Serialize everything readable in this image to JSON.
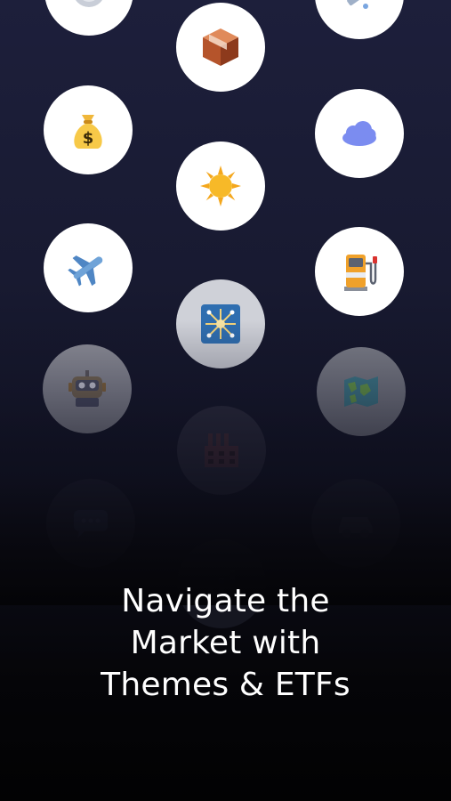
{
  "onboarding": {
    "headline_lines": [
      "Navigate the",
      "Market with",
      "Themes & ETFs"
    ]
  },
  "theme_icons": [
    "globe-icon",
    "package-box-icon",
    "syringe-icon",
    "money-bag-icon",
    "sun-icon",
    "cloud-icon",
    "airplane-icon",
    "solar-panel-icon",
    "fuel-pump-icon",
    "robot-icon",
    "world-map-icon",
    "factory-icon",
    "chat-bubble-icon",
    "vehicle-icon",
    "chart-icon"
  ]
}
